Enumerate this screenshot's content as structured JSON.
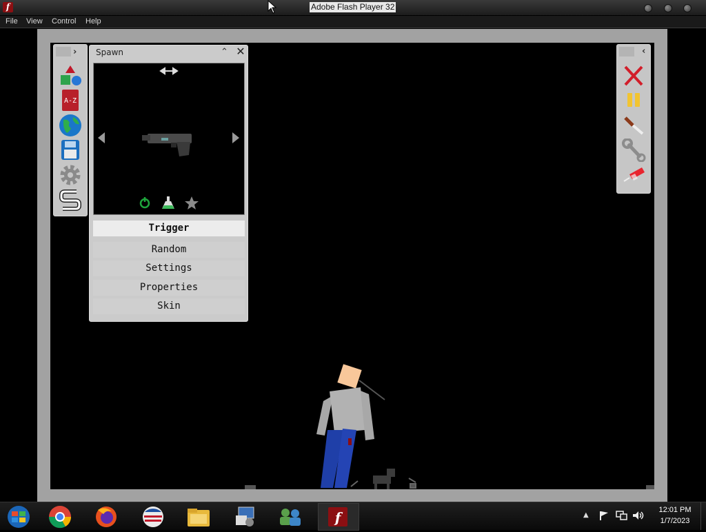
{
  "window": {
    "title": "Adobe Flash Player 32",
    "app_icon_glyph": "f"
  },
  "menubar": [
    "File",
    "View",
    "Control",
    "Help"
  ],
  "left_toolbar": {
    "tools": [
      "spawn-shapes-icon",
      "a-z-catalog-icon",
      "globe-icon",
      "save-disk-icon",
      "gear-icon",
      "s-logo-icon"
    ]
  },
  "spawn_panel": {
    "title": "Spawn",
    "preview": {
      "item": "pistol-icon",
      "footer_icons": [
        "power-icon",
        "flask-icon",
        "star-icon"
      ]
    },
    "menu": [
      "Trigger",
      "Random",
      "Settings",
      "Properties",
      "Skin"
    ],
    "selected": "Trigger"
  },
  "right_toolbar": {
    "tools": [
      "close-x-icon",
      "pause-icon",
      "knife-icon",
      "wrench-icon",
      "syringe-icon"
    ]
  },
  "taskbar": {
    "apps": [
      "windows-start-icon",
      "chrome-icon",
      "firefox-icon",
      "obs-style-icon",
      "file-explorer-icon",
      "control-panel-icon",
      "users-icon",
      "flash-player-icon"
    ],
    "time": "12:01 PM",
    "date": "1/7/2023"
  },
  "colors": {
    "stage_frame": "#a2a2a2",
    "panel": "#cbcbcb",
    "selected_button": "#ececec",
    "character_skin": "#f8c79a",
    "character_shirt": "#b0b0b0",
    "character_pants": "#1f3fa8"
  }
}
